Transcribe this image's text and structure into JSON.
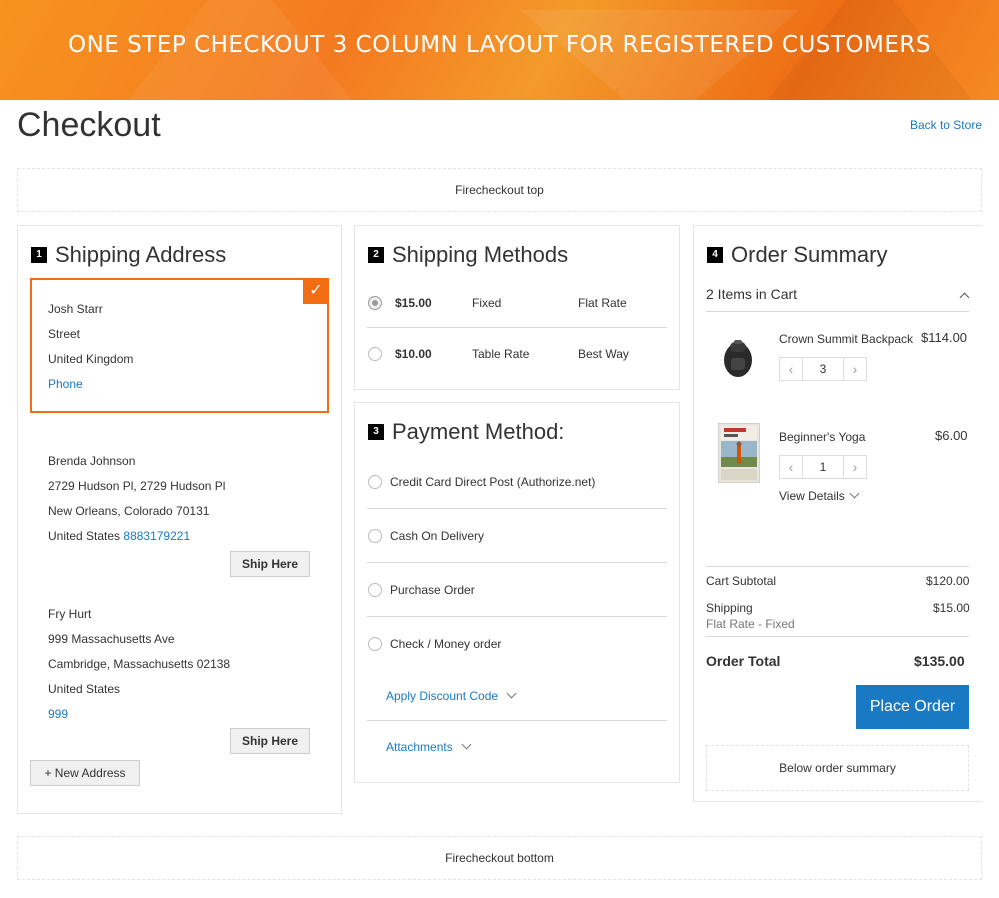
{
  "banner": {
    "title": "ONE STEP CHECKOUT 3 COLUMN LAYOUT FOR REGISTERED CUSTOMERS"
  },
  "page": {
    "title": "Checkout",
    "back_link": "Back to Store"
  },
  "placeholders": {
    "top": "Firecheckout top",
    "bottom": "Firecheckout bottom",
    "below_summary": "Below order summary"
  },
  "shipping_address": {
    "step": "1",
    "title": "Shipping Address",
    "selected": {
      "name": "Josh Starr",
      "street": "Street",
      "country": "United Kingdom",
      "phone": "Phone"
    },
    "addresses": [
      {
        "name": "Brenda Johnson",
        "street": "2729 Hudson Pl, 2729 Hudson Pl",
        "city": "New Orleans, Colorado 70131",
        "country": "United States",
        "phone": "8883179221",
        "button": "Ship Here"
      },
      {
        "name": "Fry Hurt",
        "street": "999 Massachusetts Ave",
        "city": "Cambridge, Massachusetts 02138",
        "country": "United States",
        "phone": "999",
        "button": "Ship Here"
      }
    ],
    "new_address_button": "+ New Address"
  },
  "shipping_methods": {
    "step": "2",
    "title": "Shipping Methods",
    "methods": [
      {
        "price": "$15.00",
        "method": "Fixed",
        "carrier": "Flat Rate",
        "selected": true
      },
      {
        "price": "$10.00",
        "method": "Table Rate",
        "carrier": "Best Way",
        "selected": false
      }
    ]
  },
  "payment_method": {
    "step": "3",
    "title": "Payment Method:",
    "options": [
      "Credit Card Direct Post (Authorize.net)",
      "Cash On Delivery",
      "Purchase Order",
      "Check / Money order"
    ],
    "discount_label": "Apply Discount Code",
    "attachments_label": "Attachments"
  },
  "order_summary": {
    "step": "4",
    "title": "Order Summary",
    "items_in_cart": "2 Items in Cart",
    "items": [
      {
        "name": "Crown Summit Backpack",
        "price": "$114.00",
        "qty": "3"
      },
      {
        "name": "Beginner's Yoga",
        "price": "$6.00",
        "qty": "1",
        "details_label": "View Details"
      }
    ],
    "subtotal_label": "Cart Subtotal",
    "subtotal_value": "$120.00",
    "shipping_label": "Shipping",
    "shipping_value": "$15.00",
    "shipping_method": "Flat Rate - Fixed",
    "total_label": "Order Total",
    "total_value": "$135.00",
    "place_order_button": "Place Order"
  }
}
